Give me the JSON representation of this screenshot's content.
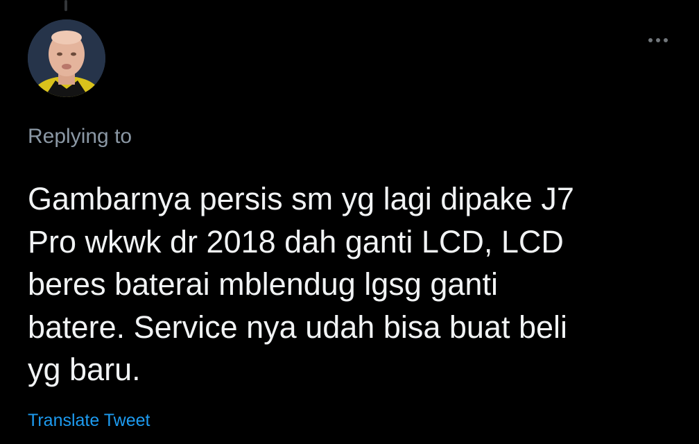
{
  "tweet": {
    "replying_label": "Replying to",
    "text_lines": [
      "Gambarnya persis sm yg lagi dipake J7",
      "Pro wkwk dr 2018 dah ganti LCD, LCD",
      "beres baterai mblendug lgsg ganti",
      "batere. Service nya udah bisa buat beli",
      "yg baru."
    ],
    "translate_label": "Translate Tweet",
    "more_icon": "more-horizontal-icon"
  },
  "colors": {
    "background": "#000000",
    "text": "#f1f3f4",
    "secondary_text": "#8b98a5",
    "link": "#1d9bf0",
    "icon": "#71767b"
  }
}
